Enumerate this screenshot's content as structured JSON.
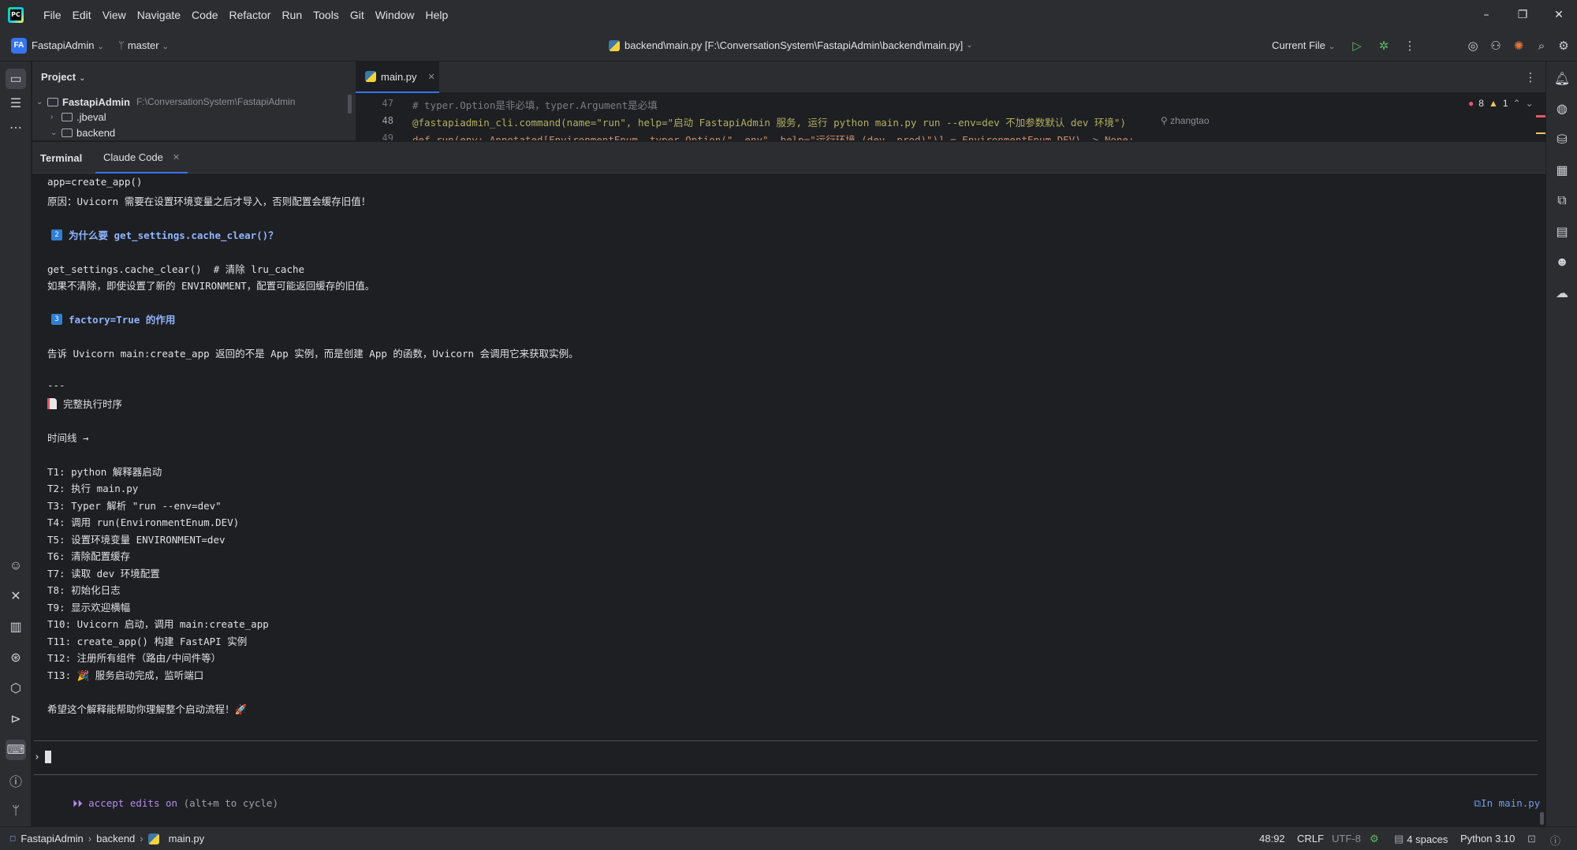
{
  "titlebar": {
    "menu": [
      "File",
      "Edit",
      "View",
      "Navigate",
      "Code",
      "Refactor",
      "Run",
      "Tools",
      "Git",
      "Window",
      "Help"
    ],
    "window_controls": [
      "minimize-icon",
      "restore-icon",
      "close-icon"
    ]
  },
  "toolbar": {
    "project_badge": "FA",
    "project_name": "FastapiAdmin",
    "branch": "master",
    "file_path": "backend\\main.py [F:\\ConversationSystem\\FastapiAdmin\\backend\\main.py]",
    "run_config": "Current File"
  },
  "project_panel": {
    "title": "Project",
    "root_name": "FastapiAdmin",
    "root_path": "F:\\ConversationSystem\\FastapiAdmin",
    "items": [
      ".jbeval",
      "backend"
    ]
  },
  "editor": {
    "tab": "main.py",
    "lines": [
      {
        "num": "47",
        "text": "# typer.Option是非必填，typer.Argument是必填"
      },
      {
        "num": "48",
        "text": "@fastapiadmin_cli.command(name=\"run\", help=\"启动 FastapiAdmin 服务, 运行 python main.py run --env=dev 不加参数默认 dev 环境\")"
      },
      {
        "num": "49",
        "text": "def run(env: Annotated[EnvironmentEnum, typer.Option(\"--env\", help=\"运行环境 (dev, prod)\")] = EnvironmentEnum.DEV) -> None:"
      }
    ],
    "author": "zhangtao",
    "errors": "8",
    "warnings": "1"
  },
  "tool_window": {
    "tabs": [
      "Terminal",
      "Claude Code"
    ]
  },
  "terminal": {
    "lines": [
      "app=create_app()",
      "原因：Uvicorn 需要在设置环境变量之后才导入，否则配置会缓存旧值！",
      "为什么要 get_settings.cache_clear()？",
      "get_settings.cache_clear()  # 清除 lru_cache",
      "如果不清除，即使设置了新的 ENVIRONMENT，配置可能返回缓存的旧值。",
      "factory=True 的作用",
      "告诉 Uvicorn main:create_app 返回的不是 App 实例，而是创建 App 的函数，Uvicorn 会调用它来获取实例。",
      "---",
      "完整执行时序",
      "时间线 →",
      "T1: python 解释器启动",
      "T2: 执行 main.py",
      "T3: Typer 解析 \"run --env=dev\"",
      "T4: 调用 run(EnvironmentEnum.DEV)",
      "T5: 设置环境变量 ENVIRONMENT=dev",
      "T6: 清除配置缓存",
      "T7: 读取 dev 环境配置",
      "T8: 初始化日志",
      "T9: 显示欢迎横幅",
      "T10: Uvicorn 启动，调用 main:create_app",
      "T11: create_app() 构建 FastAPI 实例",
      "T12: 注册所有组件（路由/中间件等）",
      "T13: 🎉 服务启动完成，监听端口",
      "希望这个解释能帮助你理解整个启动流程！🚀"
    ],
    "badges": [
      "2",
      "3"
    ],
    "prompt": "›",
    "mode_prefix": "⏵⏵",
    "mode_label": "accept edits on",
    "mode_hint": "(alt+m to cycle)",
    "context_file": "In main.py"
  },
  "statusbar": {
    "breadcrumb": [
      "FastapiAdmin",
      "backend",
      "main.py"
    ],
    "position": "48:92",
    "line_ending": "CRLF",
    "encoding": "UTF-8",
    "indent": "4 spaces",
    "interpreter": "Python 3.10"
  },
  "colors": {
    "accent": "#3574f0",
    "background": "#1e1f22",
    "panel": "#2b2d30",
    "error": "#e55765",
    "warning": "#f2c55c"
  }
}
